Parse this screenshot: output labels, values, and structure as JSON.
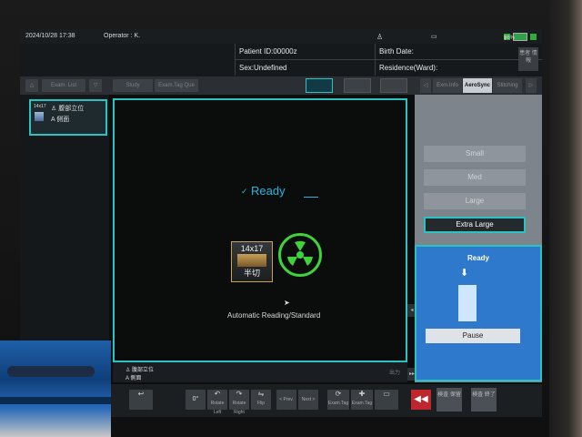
{
  "header": {
    "datetime": "2024/10/28 17:38",
    "operator": "Operator : K.",
    "battery": "86%"
  },
  "patient": {
    "id": "Patient ID:00000z",
    "sex": "Sex:Undefined",
    "birth": "Birth Date:",
    "residence": "Residence(Ward):",
    "register_button": "患者\n情報"
  },
  "toolbar": {
    "exam_list": "Exam. List",
    "study": "Study",
    "exam_tag": "Exam.Tag Que",
    "tab_exam_info": "Exm.Info",
    "tab_aerosync": "AeroSync",
    "tab_stitching": "Stitching"
  },
  "left_panel": {
    "thumb_size": "14x17",
    "thumb_line1": "腹部立位",
    "thumb_line2": "側面",
    "thumb_mark": "A"
  },
  "main": {
    "ready_label": "Ready",
    "plate_size": "14x17",
    "plate_label": "半切",
    "reading_mode": "Automatic Reading/Standard",
    "footer_line1": "腹部立位",
    "footer_line2": "側面",
    "zoom": "出力"
  },
  "right_panel": {
    "sizes": [
      "Small",
      "Med",
      "Large",
      "Extra Large"
    ],
    "selected_size": "Extra Large",
    "status_label": "Ready",
    "pause_label": "Pause"
  },
  "bottom": {
    "rotate": "0°",
    "items": [
      "Rotate Left",
      "Rotate Right",
      "Flip",
      "< Prev.",
      "Next >",
      "Exam.Tag",
      "Exam.Tag"
    ],
    "hold_button": "検査\n保留",
    "end_button": "検査\n終了"
  },
  "colors": {
    "accent": "#2ac3c3",
    "ready": "#27b6e0",
    "radiation": "#3fd23a",
    "status_panel": "#2f79cc",
    "stop_button": "#c0262d"
  }
}
